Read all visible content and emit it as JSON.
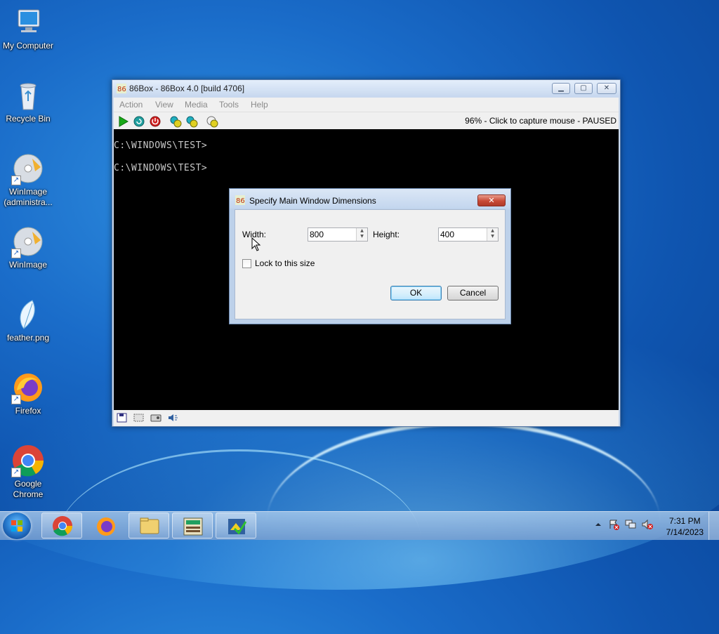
{
  "desktop": {
    "icons": [
      {
        "label": "My Computer",
        "icon": "computer-icon"
      },
      {
        "label": "Recycle Bin",
        "icon": "recycle-bin-icon"
      },
      {
        "label": "WinImage (administra...",
        "icon": "winimage-icon"
      },
      {
        "label": "WinImage",
        "icon": "winimage-icon"
      },
      {
        "label": "feather.png",
        "icon": "feather-icon"
      },
      {
        "label": "Firefox",
        "icon": "firefox-icon"
      },
      {
        "label": "Google Chrome",
        "icon": "chrome-icon"
      }
    ]
  },
  "app_window": {
    "title": "86Box - 86Box 4.0 [build 4706]",
    "menu": [
      "Action",
      "View",
      "Media",
      "Tools",
      "Help"
    ],
    "toolbar_status": "96% - Click to capture mouse - PAUSED",
    "toolbar_buttons": [
      "play-icon",
      "reset-icon",
      "power-icon",
      "settings-icon",
      "ctrl-alt-del-icon",
      "ctrl-alt-esc-icon"
    ],
    "screen_lines": [
      "C:\\WINDOWS\\TEST>",
      "C:\\WINDOWS\\TEST>"
    ],
    "status_icons": [
      "floppy-icon",
      "cdrom-icon",
      "hard-disk-icon",
      "sound-icon"
    ]
  },
  "dialog": {
    "title": "Specify Main Window Dimensions",
    "width_label": "Width:",
    "width_value": "800",
    "height_label": "Height:",
    "height_value": "400",
    "lock_label": "Lock to this size",
    "lock_checked": false,
    "ok_label": "OK",
    "cancel_label": "Cancel",
    "close_glyph": "✕"
  },
  "taskbar": {
    "apps": [
      "chrome-icon",
      "firefox-icon",
      "explorer-icon",
      "86box-icon",
      "winimage-icon"
    ],
    "clock_time": "7:31 PM",
    "clock_date": "7/14/2023"
  }
}
